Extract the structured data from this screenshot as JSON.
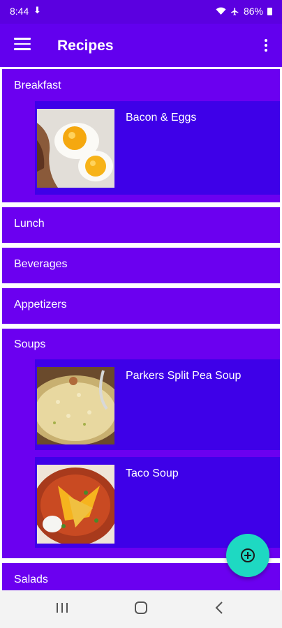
{
  "status": {
    "time": "8:44",
    "battery": "86%"
  },
  "app_bar": {
    "title": "Recipes",
    "menu_icon": "hamburger-menu-icon",
    "overflow_icon": "more-vert-icon"
  },
  "categories": [
    {
      "label": "Breakfast",
      "recipes": [
        {
          "name": "Bacon & Eggs"
        }
      ]
    },
    {
      "label": "Lunch"
    },
    {
      "label": "Beverages"
    },
    {
      "label": "Appetizers"
    },
    {
      "label": "Soups",
      "recipes": [
        {
          "name": "Parkers Split Pea Soup"
        },
        {
          "name": "Taco Soup"
        }
      ]
    },
    {
      "label": "Salads"
    }
  ],
  "fab": {
    "icon": "add-circle-icon"
  },
  "colors": {
    "status_bar": "#5b00e0",
    "app_bar": "#6200ee",
    "category": "#6b00f0",
    "recipe": "#3e00e8",
    "fab": "#1ed9c2"
  }
}
